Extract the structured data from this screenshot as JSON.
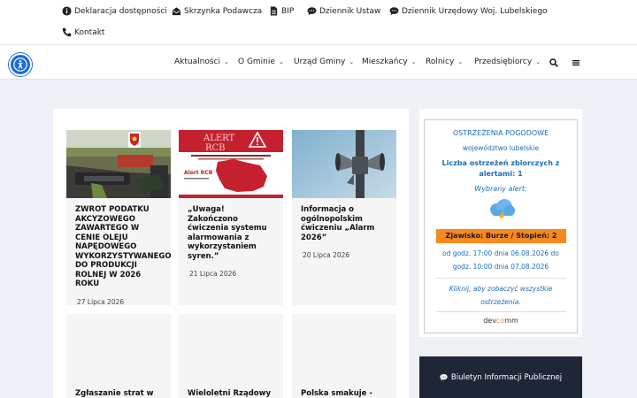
{
  "topbar": {
    "links": [
      {
        "label": "Deklaracja dostępności",
        "icon": "info-circle-icon"
      },
      {
        "label": "Skrzynka Podawcza",
        "icon": "envelope-open-icon"
      },
      {
        "label": "BIP",
        "icon": "file-icon"
      },
      {
        "label": "Dziennik Ustaw",
        "icon": "comments-icon"
      },
      {
        "label": "Dziennik Urzędowy Woj. Lubelskiego",
        "icon": "comments-icon"
      },
      {
        "label": "Kontakt",
        "icon": "phone-icon"
      }
    ]
  },
  "nav": {
    "items": [
      "Aktualności",
      "O Gminie",
      "Urząd Gminy",
      "Mieszkańcy",
      "Rolnicy",
      "Przedsiębiorcy"
    ],
    "search_icon": "search-icon",
    "menu_icon": "hamburger-menu-icon",
    "accessibility_icon": "accessibility-icon"
  },
  "posts": [
    {
      "title": "ZWROT PODATKU AKCYZOWEGO ZAWARTEGO W CENIE OLEJU NAPĘDOWEGO WYKORZYSTYWANEGO DO PRODUKCJI ROLNEJ W 2026 ROKU",
      "date": "27 Lipca 2026",
      "image": "fuel-nozzle-photo"
    },
    {
      "title": "„Uwaga! Zakończono ćwiczenia systemu alarmowania z wykorzystaniem syren.”",
      "date": "21 Lipca 2026",
      "image": "alert-rcb-graphic",
      "image_text": {
        "line1": "ALERT",
        "line2": "RCB",
        "caption": "Alert RCB"
      }
    },
    {
      "title": "Informacja o ogólnopolskim ćwiczeniu „Alarm 2026”",
      "date": "20 Lipca 2026",
      "image": "siren-photo"
    },
    {
      "title": "Zgłaszanie strat w",
      "date": "",
      "image": ""
    },
    {
      "title": "Wieloletni Rządowy",
      "date": "",
      "image": ""
    },
    {
      "title": "Polska smakuje -",
      "date": "",
      "image": ""
    }
  ],
  "weather": {
    "title": "OSTRZEŻENIA POGODOWE",
    "region": "województwo lubelskie",
    "count_label": "Liczba ostrzeżeń zbiorczych z alertami: 1",
    "chosen_label": "Wybrany alert:",
    "icon": "storm-cloud-icon",
    "phenomenon": "Zjawisko: Burze / Stopień: 2",
    "time_from": "od godz. 17:00 dnia 06.08.2026 do",
    "time_to": "godz. 10:00 dnia 07.08.2026",
    "click_note": "Kliknij, aby zobaczyć wszystkie ostrzeżenia.",
    "brand_pre": "dev",
    "brand_mid": "co",
    "brand_post": "mm",
    "accent": "#f7891f",
    "text_color": "#1b6db7"
  },
  "bip": {
    "label": "Biuletyn Informacji Publicznej",
    "icon": "comments-icon"
  }
}
